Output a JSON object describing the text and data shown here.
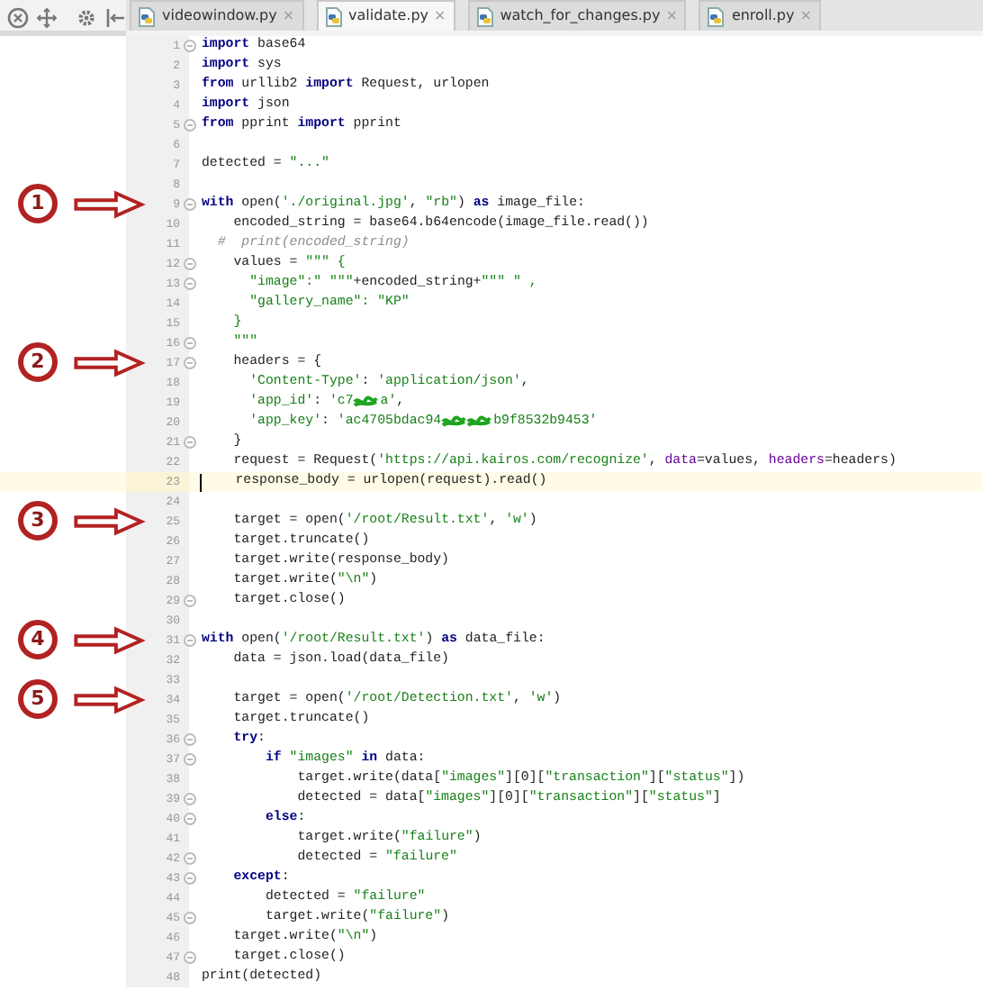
{
  "toolbar": {
    "tools": [
      {
        "kind": "target"
      },
      {
        "kind": "move"
      },
      {
        "kind": "gear"
      },
      {
        "kind": "collapse"
      }
    ]
  },
  "tabs": [
    {
      "label": "videowindow.py",
      "selected": false,
      "close": "×"
    },
    {
      "label": "validate.py",
      "selected": true,
      "close": "×"
    },
    {
      "label": "watch_for_changes.py",
      "selected": false,
      "close": "×"
    },
    {
      "label": "enroll.py",
      "selected": false,
      "close": "×"
    }
  ],
  "lines": [
    {
      "number": "1",
      "fold": true,
      "current": false,
      "tokens": [
        {
          "kind": "kw",
          "text": "import"
        },
        {
          "kind": "txt",
          "text": " base64"
        }
      ]
    },
    {
      "number": "2",
      "fold": false,
      "current": false,
      "tokens": [
        {
          "kind": "kw",
          "text": "import"
        },
        {
          "kind": "txt",
          "text": " sys"
        }
      ]
    },
    {
      "number": "3",
      "fold": false,
      "current": false,
      "tokens": [
        {
          "kind": "kw",
          "text": "from"
        },
        {
          "kind": "txt",
          "text": " urllib2 "
        },
        {
          "kind": "kw",
          "text": "import"
        },
        {
          "kind": "txt",
          "text": " Request, urlopen"
        }
      ]
    },
    {
      "number": "4",
      "fold": false,
      "current": false,
      "tokens": [
        {
          "kind": "kw",
          "text": "import"
        },
        {
          "kind": "txt",
          "text": " json"
        }
      ]
    },
    {
      "number": "5",
      "fold": true,
      "current": false,
      "tokens": [
        {
          "kind": "kw",
          "text": "from"
        },
        {
          "kind": "txt",
          "text": " pprint "
        },
        {
          "kind": "kw",
          "text": "import"
        },
        {
          "kind": "txt",
          "text": " pprint"
        }
      ]
    },
    {
      "number": "6",
      "fold": false,
      "current": false
    },
    {
      "number": "7",
      "fold": false,
      "current": false,
      "tokens": [
        {
          "kind": "txt",
          "text": "detected = "
        },
        {
          "kind": "str",
          "text": "\"...\""
        }
      ]
    },
    {
      "number": "8",
      "fold": false,
      "current": false
    },
    {
      "number": "9",
      "fold": true,
      "current": false,
      "marker": "1",
      "tokens": [
        {
          "kind": "kw",
          "text": "with"
        },
        {
          "kind": "txt",
          "text": " open("
        },
        {
          "kind": "str",
          "text": "'./original.jpg'"
        },
        {
          "kind": "txt",
          "text": ", "
        },
        {
          "kind": "str",
          "text": "\"rb\""
        },
        {
          "kind": "txt",
          "text": ") "
        },
        {
          "kind": "kw",
          "text": "as"
        },
        {
          "kind": "txt",
          "text": " image_file:"
        }
      ]
    },
    {
      "number": "10",
      "fold": false,
      "current": false,
      "tokens": [
        {
          "kind": "txt",
          "text": "    encoded_string = base64.b64encode(image_file.read())"
        }
      ]
    },
    {
      "number": "11",
      "fold": false,
      "current": false,
      "tokens": [
        {
          "kind": "com",
          "text": "  #  print(encoded_string)"
        }
      ]
    },
    {
      "number": "12",
      "fold": true,
      "current": false,
      "tokens": [
        {
          "kind": "txt",
          "text": "    values = "
        },
        {
          "kind": "str",
          "text": "\"\"\" {"
        }
      ]
    },
    {
      "number": "13",
      "fold": true,
      "current": false,
      "tokens": [
        {
          "kind": "str",
          "text": "      \"image\":\" \"\"\""
        },
        {
          "kind": "txt",
          "text": "+encoded_string+"
        },
        {
          "kind": "str",
          "text": "\"\"\" \" ,"
        }
      ]
    },
    {
      "number": "14",
      "fold": false,
      "current": false,
      "tokens": [
        {
          "kind": "str",
          "text": "      \"gallery_name\": \"KP\""
        }
      ]
    },
    {
      "number": "15",
      "fold": false,
      "current": false,
      "tokens": [
        {
          "kind": "str",
          "text": "    }"
        }
      ]
    },
    {
      "number": "16",
      "fold": true,
      "current": false,
      "tokens": [
        {
          "kind": "str",
          "text": "    \"\"\""
        }
      ]
    },
    {
      "number": "17",
      "fold": true,
      "current": false,
      "marker": "2",
      "tokens": [
        {
          "kind": "txt",
          "text": "    headers = {"
        }
      ]
    },
    {
      "number": "18",
      "fold": false,
      "current": false,
      "tokens": [
        {
          "kind": "str",
          "text": "      'Content-Type'"
        },
        {
          "kind": "txt",
          "text": ": "
        },
        {
          "kind": "str",
          "text": "'application/json'"
        },
        {
          "kind": "txt",
          "text": ","
        }
      ]
    },
    {
      "number": "19",
      "fold": false,
      "current": false,
      "tokens": [
        {
          "kind": "str",
          "text": "      'app_id'"
        },
        {
          "kind": "txt",
          "text": ": "
        },
        {
          "kind": "str",
          "text": "'c7"
        },
        {
          "kind": "redact"
        },
        {
          "kind": "str",
          "text": "a'"
        },
        {
          "kind": "txt",
          "text": ","
        }
      ]
    },
    {
      "number": "20",
      "fold": false,
      "current": false,
      "tokens": [
        {
          "kind": "str",
          "text": "      'app_key'"
        },
        {
          "kind": "txt",
          "text": ": "
        },
        {
          "kind": "str",
          "text": "'ac4705bdac94"
        },
        {
          "kind": "redact"
        },
        {
          "kind": "redact"
        },
        {
          "kind": "str",
          "text": "b9f8532b9453'"
        }
      ]
    },
    {
      "number": "21",
      "fold": true,
      "current": false,
      "tokens": [
        {
          "kind": "txt",
          "text": "    }"
        }
      ]
    },
    {
      "number": "22",
      "fold": false,
      "current": false,
      "tokens": [
        {
          "kind": "txt",
          "text": "    request = Request("
        },
        {
          "kind": "str",
          "text": "'https://api.kairos.com/recognize'"
        },
        {
          "kind": "txt",
          "text": ", "
        },
        {
          "kind": "arg",
          "text": "data"
        },
        {
          "kind": "txt",
          "text": "=values, "
        },
        {
          "kind": "arg",
          "text": "headers"
        },
        {
          "kind": "txt",
          "text": "=headers)"
        }
      ]
    },
    {
      "number": "23",
      "fold": false,
      "current": true,
      "tokens": [
        {
          "kind": "txt",
          "text": "    response_body = urlopen(request).read()"
        }
      ]
    },
    {
      "number": "24",
      "fold": false,
      "current": false
    },
    {
      "number": "25",
      "fold": false,
      "current": false,
      "marker": "3",
      "tokens": [
        {
          "kind": "txt",
          "text": "    target = open("
        },
        {
          "kind": "str",
          "text": "'/root/Result.txt'"
        },
        {
          "kind": "txt",
          "text": ", "
        },
        {
          "kind": "str",
          "text": "'w'"
        },
        {
          "kind": "txt",
          "text": ")"
        }
      ]
    },
    {
      "number": "26",
      "fold": false,
      "current": false,
      "tokens": [
        {
          "kind": "txt",
          "text": "    target.truncate()"
        }
      ]
    },
    {
      "number": "27",
      "fold": false,
      "current": false,
      "tokens": [
        {
          "kind": "txt",
          "text": "    target.write(response_body)"
        }
      ]
    },
    {
      "number": "28",
      "fold": false,
      "current": false,
      "tokens": [
        {
          "kind": "txt",
          "text": "    target.write("
        },
        {
          "kind": "str",
          "text": "\"\\n\""
        },
        {
          "kind": "txt",
          "text": ")"
        }
      ]
    },
    {
      "number": "29",
      "fold": true,
      "current": false,
      "tokens": [
        {
          "kind": "txt",
          "text": "    target.close()"
        }
      ]
    },
    {
      "number": "30",
      "fold": false,
      "current": false
    },
    {
      "number": "31",
      "fold": true,
      "current": false,
      "marker": "4",
      "tokens": [
        {
          "kind": "kw",
          "text": "with"
        },
        {
          "kind": "txt",
          "text": " open("
        },
        {
          "kind": "str",
          "text": "'/root/Result.txt'"
        },
        {
          "kind": "txt",
          "text": ") "
        },
        {
          "kind": "kw",
          "text": "as"
        },
        {
          "kind": "txt",
          "text": " data_file:"
        }
      ]
    },
    {
      "number": "32",
      "fold": false,
      "current": false,
      "tokens": [
        {
          "kind": "txt",
          "text": "    data = json.load(data_file)"
        }
      ]
    },
    {
      "number": "33",
      "fold": false,
      "current": false
    },
    {
      "number": "34",
      "fold": false,
      "current": false,
      "marker": "5",
      "tokens": [
        {
          "kind": "txt",
          "text": "    target = open("
        },
        {
          "kind": "str",
          "text": "'/root/Detection.txt'"
        },
        {
          "kind": "txt",
          "text": ", "
        },
        {
          "kind": "str",
          "text": "'w'"
        },
        {
          "kind": "txt",
          "text": ")"
        }
      ]
    },
    {
      "number": "35",
      "fold": false,
      "current": false,
      "tokens": [
        {
          "kind": "txt",
          "text": "    target.truncate()"
        }
      ]
    },
    {
      "number": "36",
      "fold": true,
      "current": false,
      "tokens": [
        {
          "kind": "kw",
          "text": "    try"
        },
        {
          "kind": "txt",
          "text": ":"
        }
      ]
    },
    {
      "number": "37",
      "fold": true,
      "current": false,
      "tokens": [
        {
          "kind": "kw",
          "text": "        if"
        },
        {
          "kind": "str",
          "text": " \"images\""
        },
        {
          "kind": "kw",
          "text": " in"
        },
        {
          "kind": "txt",
          "text": " data:"
        }
      ]
    },
    {
      "number": "38",
      "fold": false,
      "current": false,
      "tokens": [
        {
          "kind": "txt",
          "text": "            target.write(data["
        },
        {
          "kind": "str",
          "text": "\"images\""
        },
        {
          "kind": "txt",
          "text": "][0]["
        },
        {
          "kind": "str",
          "text": "\"transaction\""
        },
        {
          "kind": "txt",
          "text": "]["
        },
        {
          "kind": "str",
          "text": "\"status\""
        },
        {
          "kind": "txt",
          "text": "])"
        }
      ]
    },
    {
      "number": "39",
      "fold": true,
      "current": false,
      "tokens": [
        {
          "kind": "txt",
          "text": "            detected = data["
        },
        {
          "kind": "str",
          "text": "\"images\""
        },
        {
          "kind": "txt",
          "text": "][0]["
        },
        {
          "kind": "str",
          "text": "\"transaction\""
        },
        {
          "kind": "txt",
          "text": "]["
        },
        {
          "kind": "str",
          "text": "\"status\""
        },
        {
          "kind": "txt",
          "text": "]"
        }
      ]
    },
    {
      "number": "40",
      "fold": true,
      "current": false,
      "tokens": [
        {
          "kind": "kw",
          "text": "        else"
        },
        {
          "kind": "txt",
          "text": ":"
        }
      ]
    },
    {
      "number": "41",
      "fold": false,
      "current": false,
      "tokens": [
        {
          "kind": "txt",
          "text": "            target.write("
        },
        {
          "kind": "str",
          "text": "\"failure\""
        },
        {
          "kind": "txt",
          "text": ")"
        }
      ]
    },
    {
      "number": "42",
      "fold": true,
      "current": false,
      "tokens": [
        {
          "kind": "txt",
          "text": "            detected = "
        },
        {
          "kind": "str",
          "text": "\"failure\""
        }
      ]
    },
    {
      "number": "43",
      "fold": true,
      "current": false,
      "tokens": [
        {
          "kind": "kw",
          "text": "    except"
        },
        {
          "kind": "txt",
          "text": ":"
        }
      ]
    },
    {
      "number": "44",
      "fold": false,
      "current": false,
      "tokens": [
        {
          "kind": "txt",
          "text": "        detected = "
        },
        {
          "kind": "str",
          "text": "\"failure\""
        }
      ]
    },
    {
      "number": "45",
      "fold": true,
      "current": false,
      "tokens": [
        {
          "kind": "txt",
          "text": "        target.write("
        },
        {
          "kind": "str",
          "text": "\"failure\""
        },
        {
          "kind": "txt",
          "text": ")"
        }
      ]
    },
    {
      "number": "46",
      "fold": false,
      "current": false,
      "tokens": [
        {
          "kind": "txt",
          "text": "    target.write("
        },
        {
          "kind": "str",
          "text": "\"\\n\""
        },
        {
          "kind": "txt",
          "text": ")"
        }
      ]
    },
    {
      "number": "47",
      "fold": true,
      "current": false,
      "tokens": [
        {
          "kind": "txt",
          "text": "    target.close()"
        }
      ]
    },
    {
      "number": "48",
      "fold": false,
      "current": false,
      "tokens": [
        {
          "kind": "txt",
          "text": "print(detected)"
        }
      ]
    }
  ]
}
